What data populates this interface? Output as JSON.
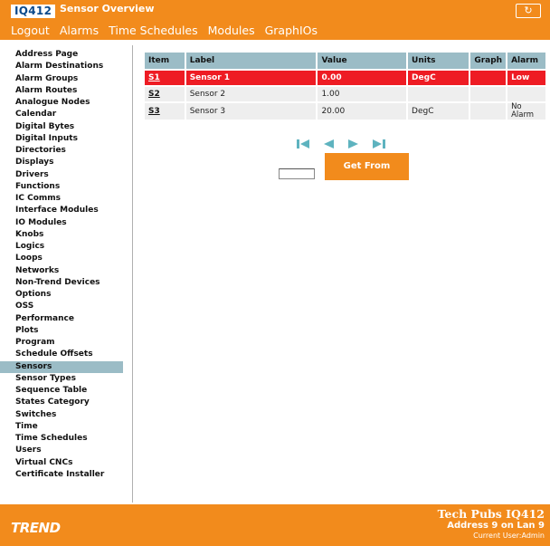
{
  "header": {
    "logo_text": "IQ412",
    "title": "Sensor Overview",
    "refresh_icon": "refresh-icon",
    "nav": [
      "Logout",
      "Alarms",
      "Time Schedules",
      "Modules",
      "GraphIOs"
    ]
  },
  "sidebar": {
    "items": [
      "Address Page",
      "Alarm Destinations",
      "Alarm Groups",
      "Alarm Routes",
      "Analogue Nodes",
      "Calendar",
      "Digital Bytes",
      "Digital Inputs",
      "Directories",
      "Displays",
      "Drivers",
      "Functions",
      "IC Comms",
      "Interface Modules",
      "IO Modules",
      "Knobs",
      "Logics",
      "Loops",
      "Networks",
      "Non-Trend Devices",
      "Options",
      "OSS",
      "Performance",
      "Plots",
      "Program",
      "Schedule Offsets",
      "Sensors",
      "Sensor Types",
      "Sequence Table",
      "States Category",
      "Switches",
      "Time",
      "Time Schedules",
      "Users",
      "Virtual CNCs",
      "Certificate Installer"
    ],
    "active": "Sensors"
  },
  "table": {
    "columns": [
      "Item",
      "Label",
      "Value",
      "Units",
      "Graph",
      "Alarm"
    ],
    "rows": [
      {
        "item": "S1",
        "label": "Sensor 1",
        "value": "0.00",
        "units": "DegC",
        "graph": "",
        "alarm": "Low",
        "in_alarm": true
      },
      {
        "item": "S2",
        "label": "Sensor 2",
        "value": "1.00",
        "units": "",
        "graph": "",
        "alarm": "",
        "in_alarm": false
      },
      {
        "item": "S3",
        "label": "Sensor 3",
        "value": "20.00",
        "units": "DegC",
        "graph": "",
        "alarm": "No Alarm",
        "in_alarm": false
      }
    ]
  },
  "pager": {
    "icons": [
      "first-page-icon",
      "previous-page-icon",
      "next-page-icon",
      "last-page-icon"
    ]
  },
  "get_from": {
    "input_value": "",
    "button_label": "Get From"
  },
  "footer": {
    "brand": "TREND",
    "device_name": "Tech Pubs IQ412",
    "address": "Address 9 on Lan 9",
    "user": "Current User:Admin"
  },
  "colors": {
    "brand_orange": "#f28b1c",
    "header_blue": "#9bbcc6",
    "alarm_red": "#ee1c24",
    "pager_teal": "#5eb3bf"
  }
}
